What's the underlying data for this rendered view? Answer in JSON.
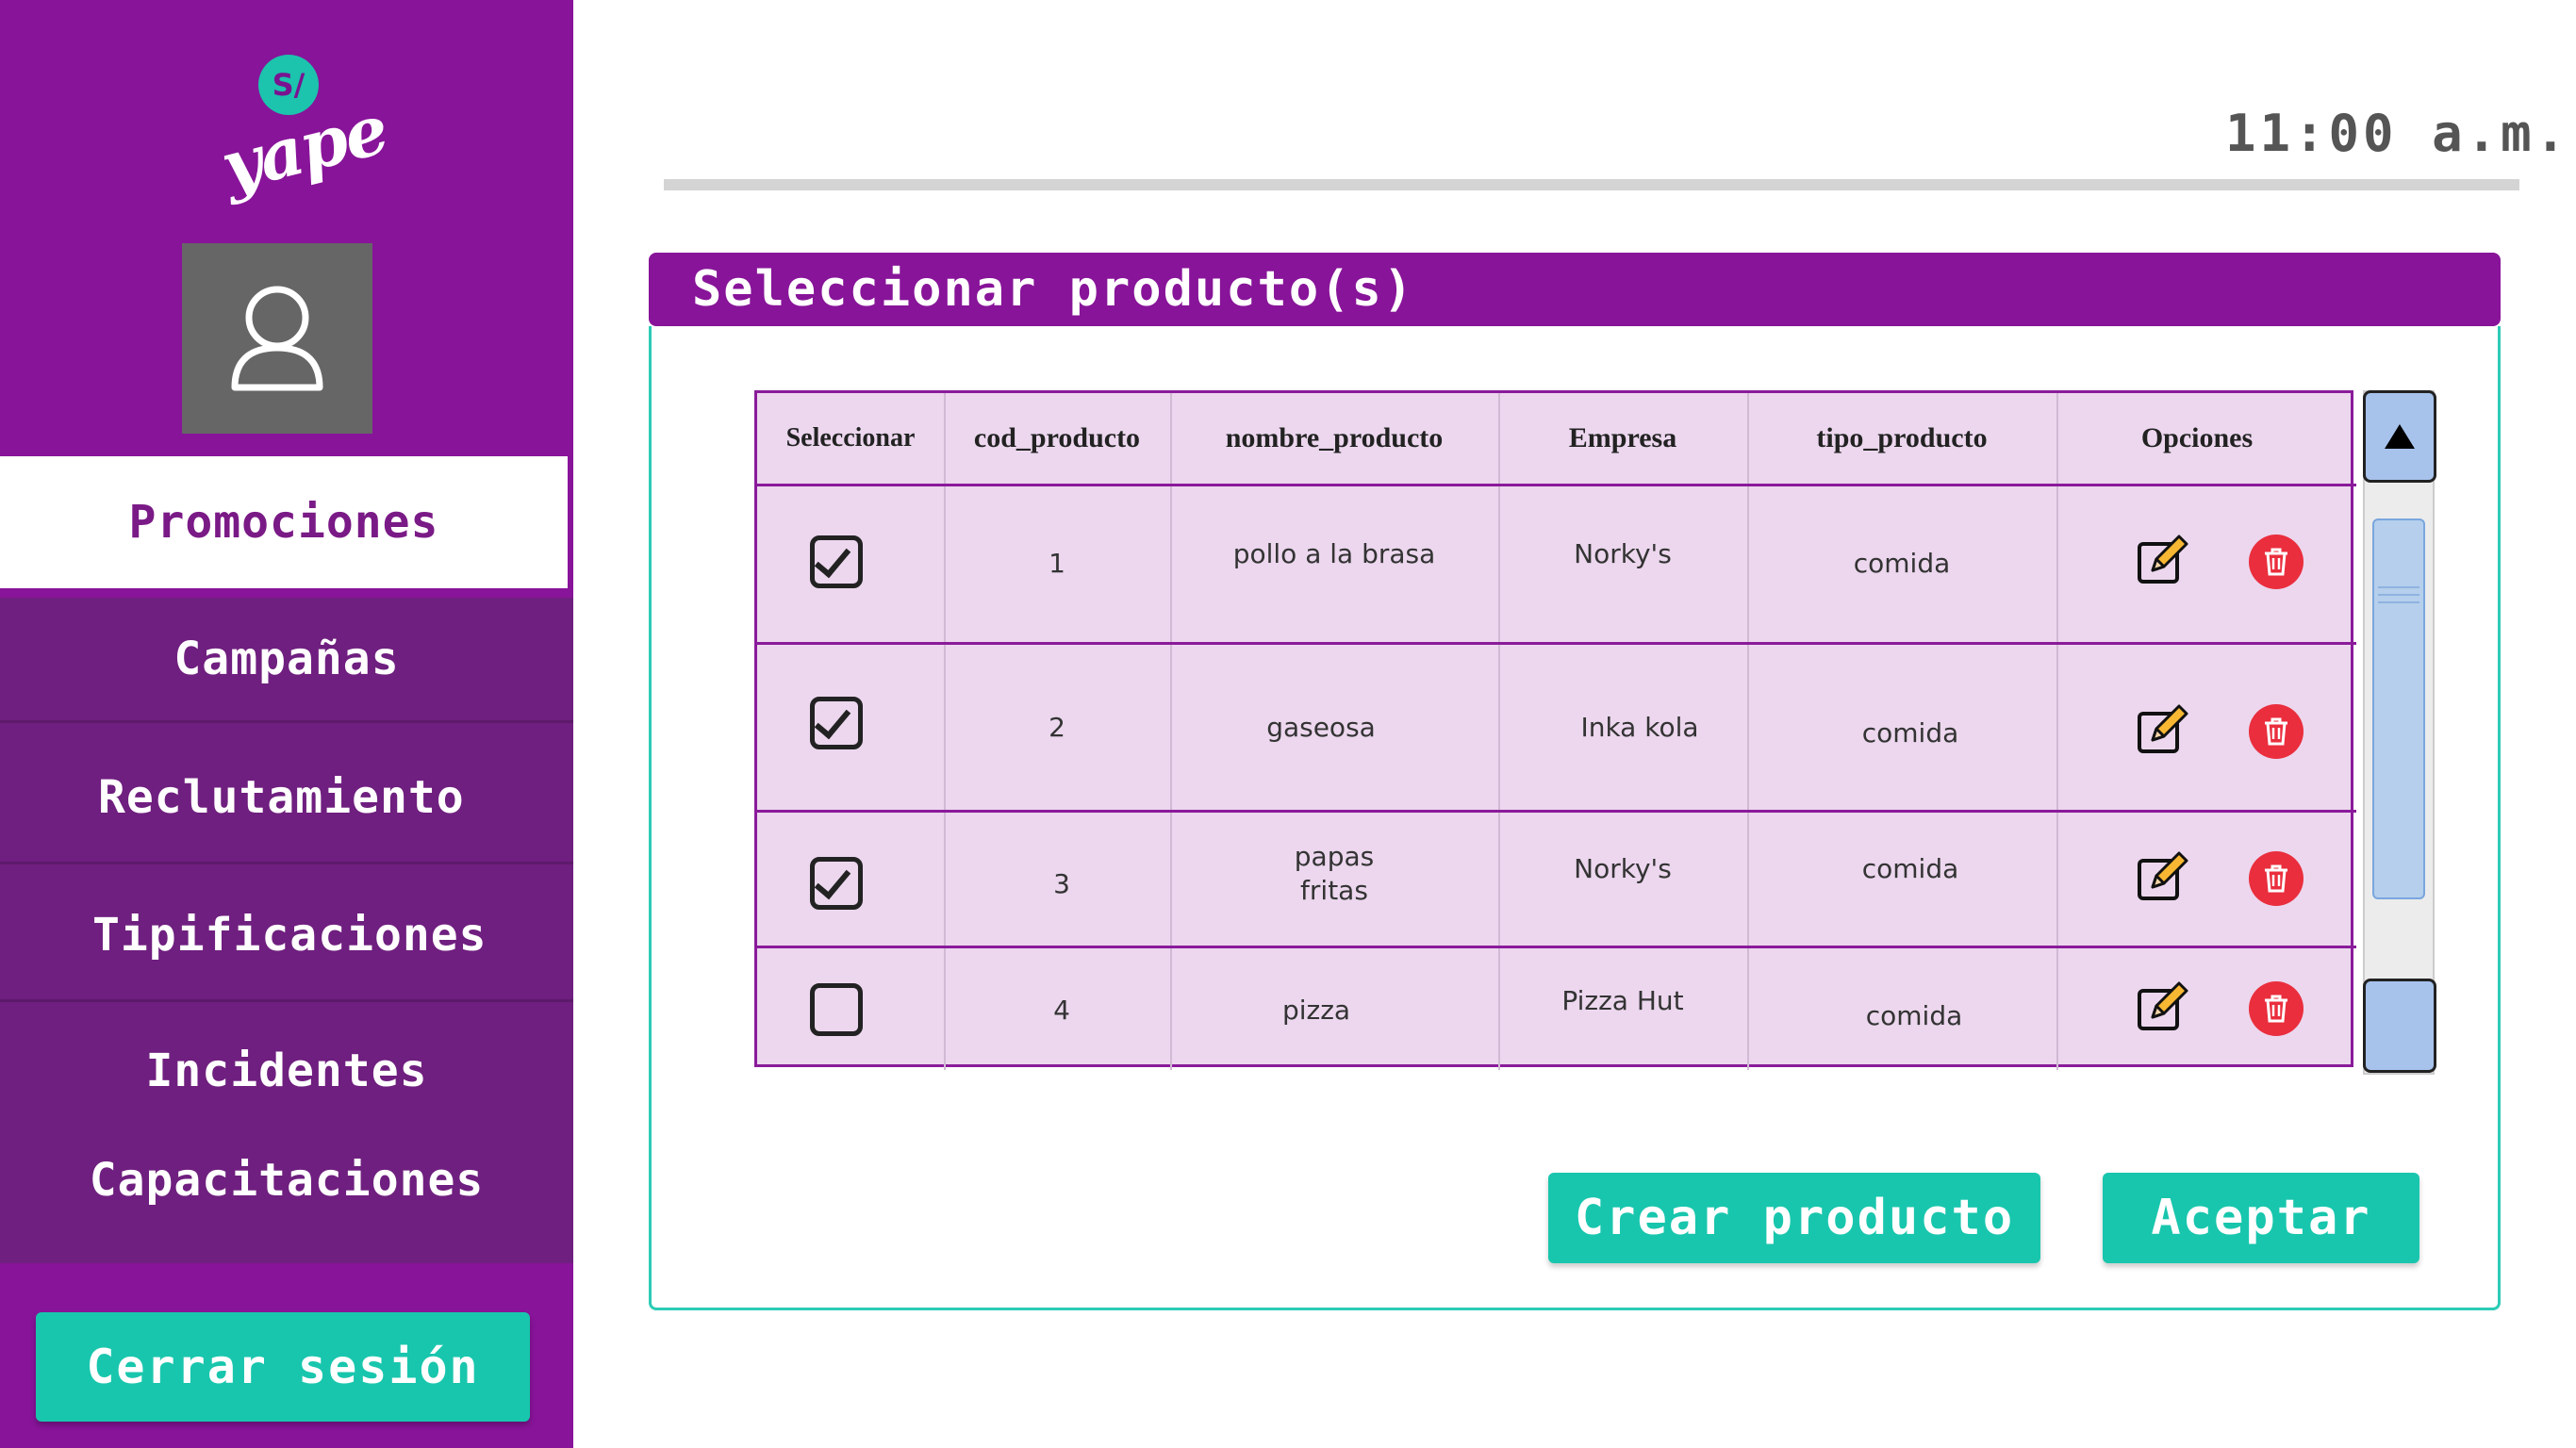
{
  "brand": {
    "logo_symbol": "S/",
    "logo_text": "yape",
    "primary_color": "#881499",
    "accent_color": "#18c6ad"
  },
  "sidebar": {
    "items": [
      {
        "label": "Promociones",
        "active": true
      },
      {
        "label": "Campañas"
      },
      {
        "label": "Reclutamiento"
      },
      {
        "label": "Tipificaciones"
      },
      {
        "label": "Incidentes"
      },
      {
        "label": "Capacitaciones"
      }
    ],
    "logout_label": "Cerrar sesión"
  },
  "header": {
    "time": "11:00 a.m."
  },
  "panel": {
    "title": "Seleccionar producto(s)",
    "columns": [
      "Seleccionar",
      "cod_producto",
      "nombre_producto",
      "Empresa",
      "tipo_producto",
      "Opciones"
    ],
    "rows": [
      {
        "selected": true,
        "cod": "1",
        "nombre": "pollo a la brasa",
        "empresa": "Norky's",
        "tipo": "comida"
      },
      {
        "selected": true,
        "cod": "2",
        "nombre": "gaseosa",
        "empresa": "Inka kola",
        "tipo": "comida"
      },
      {
        "selected": true,
        "cod": "3",
        "nombre": "papas\nfritas",
        "empresa": "Norky's",
        "tipo": "comida"
      },
      {
        "selected": false,
        "cod": "4",
        "nombre": "pizza",
        "empresa": "Pizza Hut",
        "tipo": "comida"
      }
    ],
    "create_label": "Crear producto",
    "accept_label": "Aceptar"
  },
  "icons": {
    "edit": "pencil-edit-icon",
    "delete": "trash-icon",
    "scroll_up": "triangle-up-icon"
  }
}
